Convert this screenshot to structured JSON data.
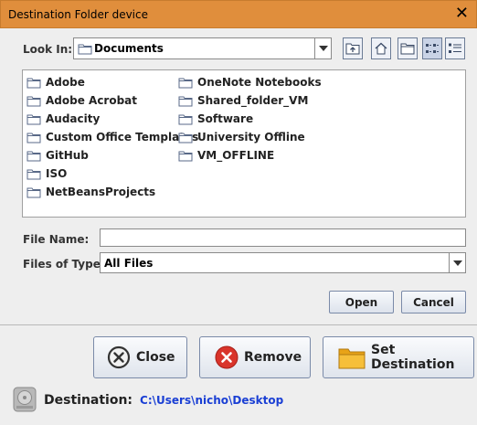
{
  "window": {
    "title": "Destination Folder device",
    "close_glyph": "✕"
  },
  "look_in": {
    "label": "Look In:",
    "value": "Documents"
  },
  "toolbar": {
    "icons": [
      "up-one-level-icon",
      "home-icon",
      "new-folder-icon",
      "list-view-icon",
      "details-view-icon"
    ],
    "selected": "list-view-icon"
  },
  "files": {
    "column1": [
      "Adobe",
      "Adobe Acrobat",
      "Audacity",
      "Custom Office Templates",
      "GitHub",
      "ISO",
      "NetBeansProjects"
    ],
    "column2": [
      "OneNote Notebooks",
      "Shared_folder_VM",
      "Software",
      "University Offline",
      "VM_OFFLINE"
    ]
  },
  "file_name": {
    "label": "File Name:",
    "value": ""
  },
  "files_of_type": {
    "label": "Files of Type:",
    "value": "All Files"
  },
  "dialog_buttons": {
    "open": "Open",
    "cancel": "Cancel"
  },
  "actions": {
    "close": "Close",
    "remove": "Remove",
    "set_destination": "Set Destination"
  },
  "destination": {
    "label": "Destination:",
    "path": "C:\\Users\\nicho\\Desktop"
  },
  "colors": {
    "titlebar": "#e08e3c",
    "path_text": "#1a3fd4",
    "remove_red": "#d9342b"
  }
}
